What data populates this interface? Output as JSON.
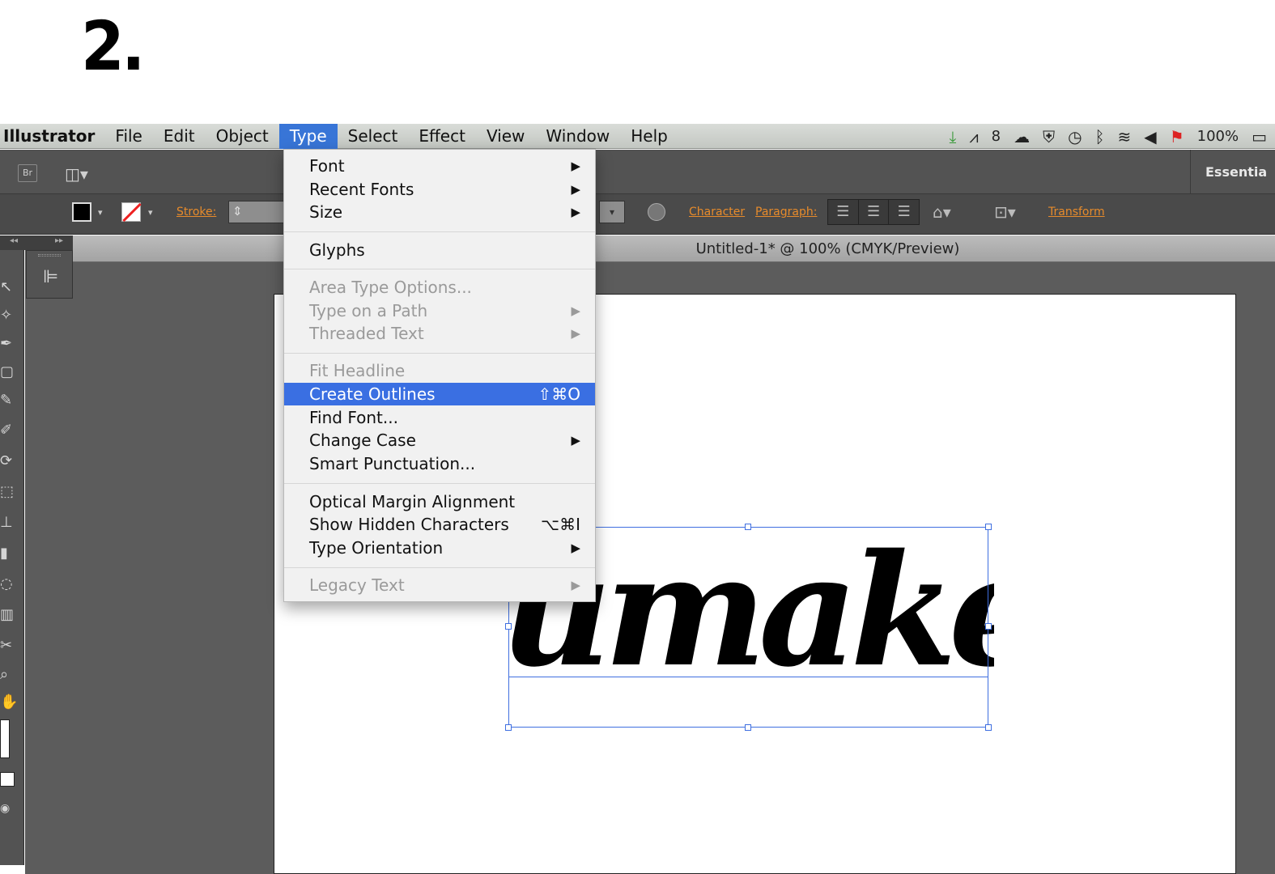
{
  "step": {
    "number": "2."
  },
  "menubar": {
    "app_name": "Illustrator",
    "items": [
      "File",
      "Edit",
      "Object",
      "Type",
      "Select",
      "Effect",
      "View",
      "Window",
      "Help"
    ],
    "active_item": "Type",
    "status": {
      "adobe_count": "8",
      "battery": "100%"
    }
  },
  "appbar": {
    "bridge_label": "Br",
    "workspace": "Essentia"
  },
  "controlbar": {
    "stroke_label": "Stroke:",
    "character_label": "Character",
    "paragraph_label": "Paragraph:",
    "transform_label": "Transform"
  },
  "document": {
    "tab_title": "Untitled-1* @ 100% (CMYK/Preview)",
    "text_content": "umake"
  },
  "type_menu": {
    "font": "Font",
    "recent_fonts": "Recent Fonts",
    "size": "Size",
    "glyphs": "Glyphs",
    "area_type_options": "Area Type Options...",
    "type_on_path": "Type on a Path",
    "threaded_text": "Threaded Text",
    "fit_headline": "Fit Headline",
    "create_outlines": "Create Outlines",
    "create_outlines_shortcut": "⇧⌘O",
    "find_font": "Find Font...",
    "change_case": "Change Case",
    "smart_punctuation": "Smart Punctuation...",
    "optical_margin": "Optical Margin Alignment",
    "show_hidden": "Show Hidden Characters",
    "show_hidden_shortcut": "⌥⌘I",
    "type_orientation": "Type Orientation",
    "legacy_text": "Legacy Text"
  },
  "colors": {
    "highlight": "#3a6fe2",
    "accent_link": "#e78b2b",
    "selection": "#3f6fe0"
  }
}
